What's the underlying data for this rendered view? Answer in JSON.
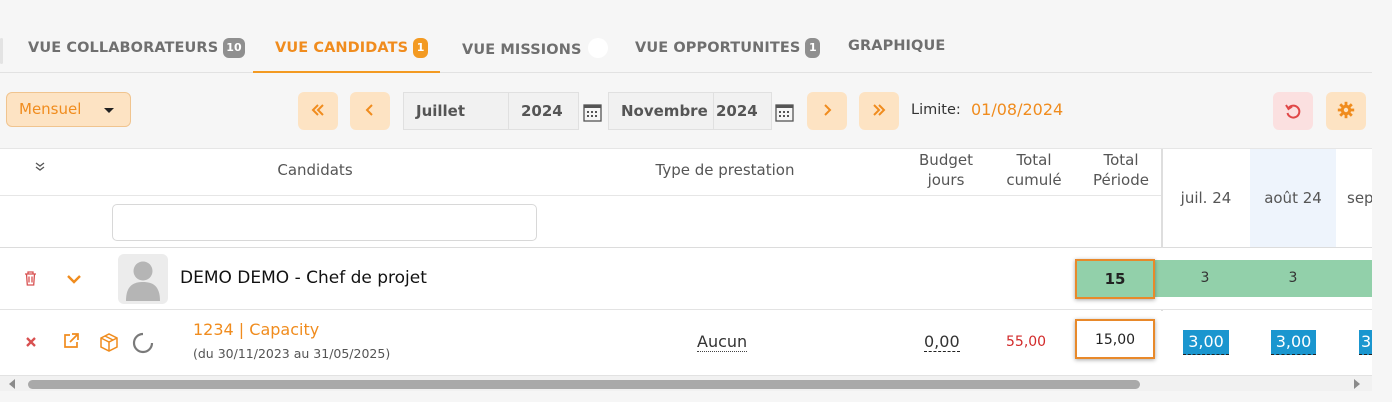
{
  "tabs": [
    {
      "label": "VUE COLLABORATEURS",
      "badge": "10"
    },
    {
      "label": "VUE CANDIDATS",
      "badge": "1"
    },
    {
      "label": "VUE MISSIONS",
      "badge": ""
    },
    {
      "label": "VUE OPPORTUNITES",
      "badge": "1"
    },
    {
      "label": "GRAPHIQUE"
    }
  ],
  "toolbar": {
    "period": "Mensuel",
    "first_icon": "double-chevron-left-icon",
    "prev_icon": "chevron-left-icon",
    "start_month": "Juillet",
    "start_year": "2024",
    "end_month": "Novembre",
    "end_year": "2024",
    "next_icon": "chevron-right-icon",
    "last_icon": "double-chevron-right-icon",
    "limit_label": "Limite:",
    "limit_value": "01/08/2024",
    "reset_icon": "undo-icon",
    "settings_icon": "gear-icon"
  },
  "table": {
    "headers": {
      "candidates": "Candidats",
      "service_type": "Type de prestation",
      "budget_1": "Budget",
      "budget_2": "jours",
      "cumul_1": "Total",
      "cumul_2": "cumulé",
      "period_1": "Total",
      "period_2": "Période",
      "months": [
        "juil. 24",
        "août 24",
        "sep"
      ]
    },
    "candidate": {
      "name": "DEMO DEMO - Chef de projet",
      "total": "15",
      "months": [
        "3",
        "3"
      ]
    },
    "mission": {
      "link": "1234 | Capacity",
      "dates": "(du 30/11/2023 au 31/05/2025)",
      "service": "Aucun",
      "budget": "0,00",
      "cumul": "55,00",
      "total": "15,00",
      "months": [
        "3,00",
        "3,00",
        "3"
      ]
    }
  },
  "colors": {
    "accent": "#f08c1e",
    "accent_light": "#fde3c3",
    "green": "#92d0aa",
    "blue": "#1a96cf",
    "red": "#d22a2a"
  }
}
